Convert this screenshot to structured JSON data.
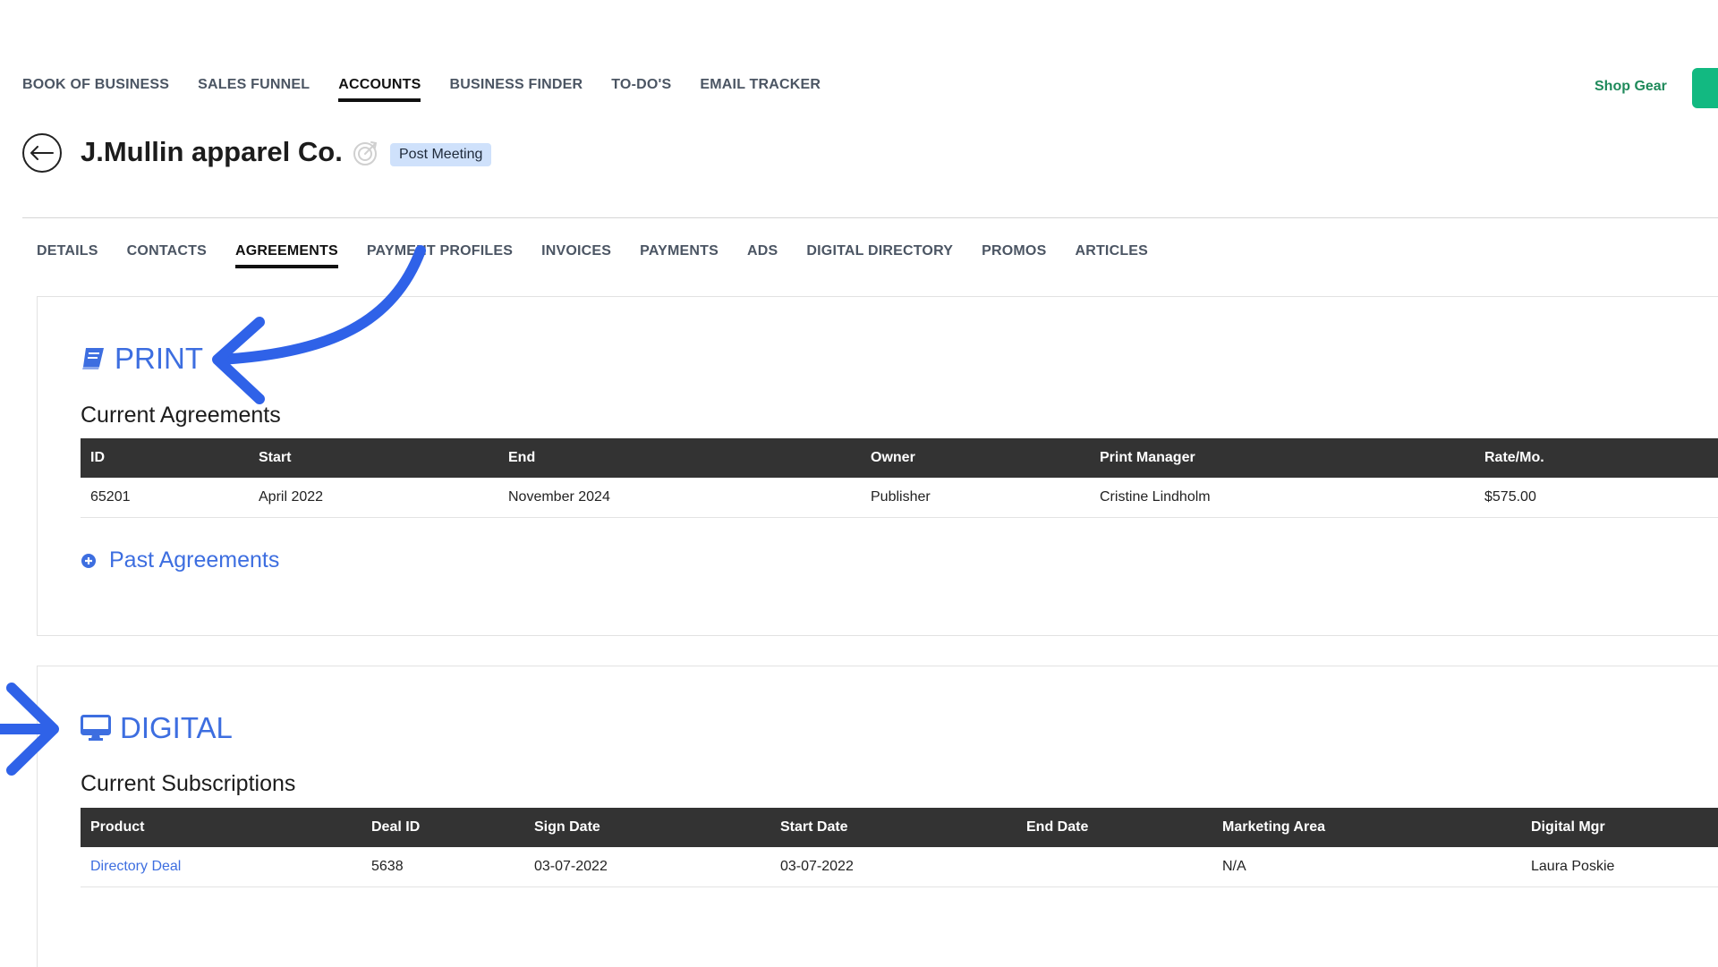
{
  "topnav": {
    "items": [
      {
        "label": "BOOK OF BUSINESS"
      },
      {
        "label": "SALES FUNNEL"
      },
      {
        "label": "ACCOUNTS"
      },
      {
        "label": "BUSINESS FINDER"
      },
      {
        "label": "TO-DO'S"
      },
      {
        "label": "EMAIL TRACKER"
      }
    ],
    "active": "ACCOUNTS",
    "shop_gear": "Shop Gear"
  },
  "header": {
    "company": "J.Mullin apparel Co.",
    "status_badge": "Post Meeting"
  },
  "subtabs": {
    "items": [
      {
        "label": "DETAILS"
      },
      {
        "label": "CONTACTS"
      },
      {
        "label": "AGREEMENTS"
      },
      {
        "label": "PAYMENT PROFILES"
      },
      {
        "label": "INVOICES"
      },
      {
        "label": "PAYMENTS"
      },
      {
        "label": "ADS"
      },
      {
        "label": "DIGITAL DIRECTORY"
      },
      {
        "label": "PROMOS"
      },
      {
        "label": "ARTICLES"
      }
    ],
    "active": "AGREEMENTS"
  },
  "print": {
    "title": "PRINT",
    "subtitle": "Current Agreements",
    "columns": [
      "ID",
      "Start",
      "End",
      "Owner",
      "Print Manager",
      "Rate/Mo."
    ],
    "rows": [
      [
        "65201",
        "April 2022",
        "November 2024",
        "Publisher",
        "Cristine Lindholm",
        "$575.00"
      ]
    ],
    "past_label": "Past Agreements"
  },
  "digital": {
    "title": "DIGITAL",
    "subtitle": "Current Subscriptions",
    "columns": [
      "Product",
      "Deal ID",
      "Sign Date",
      "Start Date",
      "End Date",
      "Marketing Area",
      "Digital Mgr"
    ],
    "rows": [
      [
        "Directory Deal",
        "5638",
        "03-07-2022",
        "03-07-2022",
        "",
        "N/A",
        "Laura Poskie"
      ]
    ]
  },
  "colors": {
    "accent": "#3d6ee0",
    "annotation_arrow": "#2f62e8",
    "table_header": "#333333",
    "shop_gear": "#1f8a5b",
    "badge_bg": "#cfe1fb"
  }
}
